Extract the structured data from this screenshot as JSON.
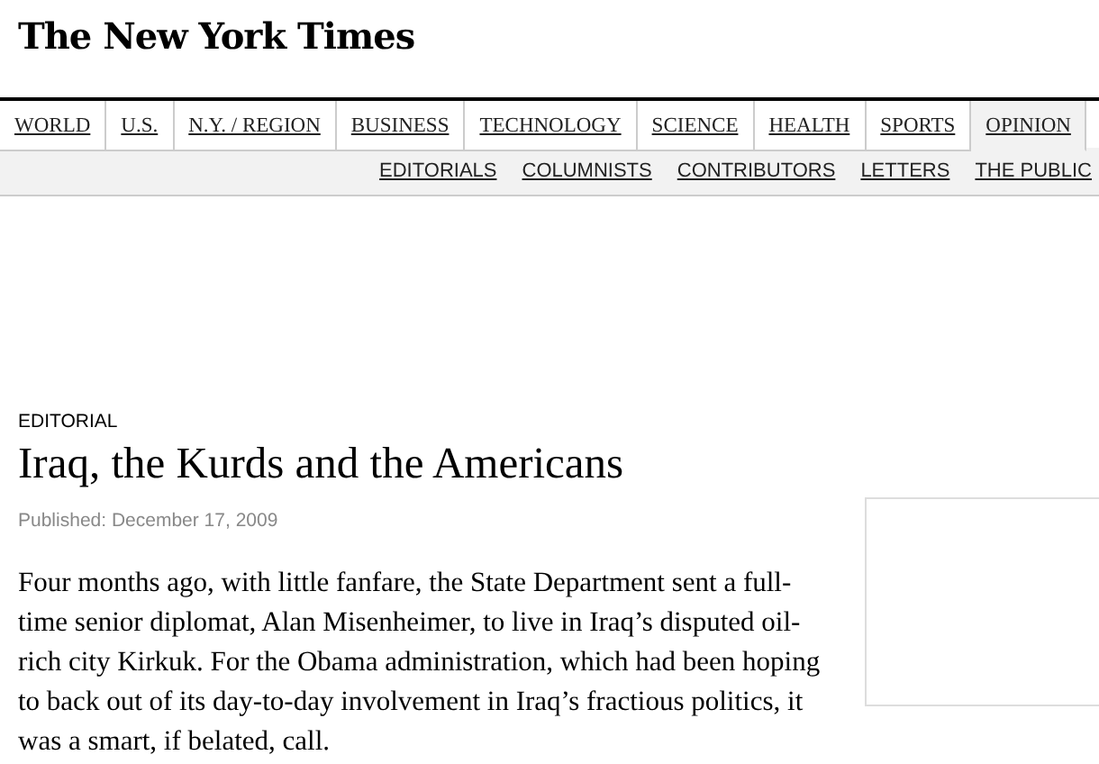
{
  "masthead": {
    "logo": "The New York Times"
  },
  "sections": [
    {
      "label": "WORLD",
      "selected": false
    },
    {
      "label": "U.S.",
      "selected": false
    },
    {
      "label": "N.Y. / REGION",
      "selected": false
    },
    {
      "label": "BUSINESS",
      "selected": false
    },
    {
      "label": "TECHNOLOGY",
      "selected": false
    },
    {
      "label": "SCIENCE",
      "selected": false
    },
    {
      "label": "HEALTH",
      "selected": false
    },
    {
      "label": "SPORTS",
      "selected": false
    },
    {
      "label": "OPINION",
      "selected": true
    }
  ],
  "subsections": [
    "EDITORIALS",
    "COLUMNISTS",
    "CONTRIBUTORS",
    "LETTERS",
    "THE PUBLIC"
  ],
  "article": {
    "kicker": "EDITORIAL",
    "headline": "Iraq, the Kurds and the Americans",
    "published": "Published: December 17, 2009",
    "body": "Four months ago, with little fanfare, the State Department sent a full-time senior diplomat, Alan Misenheimer, to live in Iraq’s disputed oil-rich city Kirkuk. For the Obama administration, which had been hoping to back out of its day-to-day involvement in Iraq’s fractious politics, it was a smart, if belated, call."
  }
}
